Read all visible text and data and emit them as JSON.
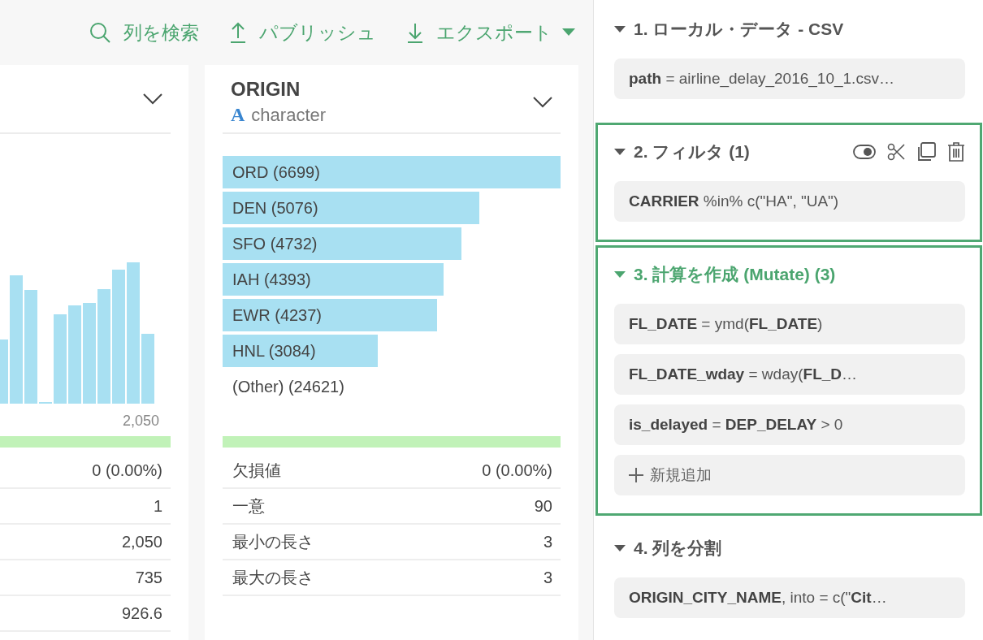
{
  "toolbar": [
    {
      "kind": "search",
      "label": "列を検索"
    },
    {
      "kind": "publish",
      "label": "パブリッシュ"
    },
    {
      "kind": "export",
      "label": "エクスポート",
      "dropdown": true
    }
  ],
  "columns": [
    {
      "kind": "histogram",
      "axis_label": "2,050",
      "valid_bar": {
        "level": 1
      },
      "stats": [
        {
          "value": "0 (0.00%)"
        },
        {
          "value": "1"
        },
        {
          "value": "2,050"
        },
        {
          "value": "735"
        },
        {
          "value": "926.6"
        }
      ]
    },
    {
      "kind": "category",
      "name": "ORIGIN",
      "type_icon": "A",
      "type": "character",
      "valid_bar": {
        "level": 1
      },
      "categories": [
        {
          "label": "ORD (6699)",
          "level": 1
        },
        {
          "label": "DEN (5076)",
          "level": 0.76
        },
        {
          "label": "SFO (4732)",
          "level": 0.707
        },
        {
          "label": "IAH (4393)",
          "level": 0.654
        },
        {
          "label": "EWR (4237)",
          "level": 0.635
        },
        {
          "label": "HNL (3084)",
          "level": 0.46
        },
        {
          "label": "(Other) (24621)"
        }
      ],
      "stats": [
        {
          "label": "欠損値",
          "value": "0 (0.00%)"
        },
        {
          "label": "一意",
          "value": "90"
        },
        {
          "label": "最小の長さ",
          "value": "3"
        },
        {
          "label": "最大の長さ",
          "value": "3"
        }
      ]
    }
  ],
  "steps": [
    {
      "title": "1. ローカル・データ - CSV",
      "expanded": true,
      "selected": false,
      "highlighted": false,
      "actions": false,
      "items": [
        {
          "kind": "expr",
          "text": "**path** = airline_delay_2016_10_1.csv…"
        }
      ]
    },
    {
      "title": "2. フィルタ (1)",
      "expanded": true,
      "selected": false,
      "highlighted": true,
      "actions": true,
      "items": [
        {
          "kind": "expr",
          "text": "**CARRIER** %in% c(\"HA\", \"UA\")"
        }
      ]
    },
    {
      "title": "3. 計算を作成 (Mutate) (3)",
      "expanded": true,
      "selected": true,
      "highlighted": true,
      "actions": false,
      "items": [
        {
          "kind": "expr",
          "text": "**FL_DATE** = ymd(**FL_DATE**)"
        },
        {
          "kind": "expr",
          "text": "**FL_DATE_wday** = wday(**FL_D**…"
        },
        {
          "kind": "expr",
          "text": "**is_delayed** = **DEP_DELAY** > 0"
        },
        {
          "kind": "add",
          "text": "新規追加"
        }
      ]
    },
    {
      "title": "4. 列を分割",
      "expanded": true,
      "selected": false,
      "highlighted": false,
      "actions": false,
      "items": [
        {
          "kind": "expr",
          "text": "**ORIGIN_CITY_NAME**, into = c(\"**Cit**…"
        }
      ]
    }
  ]
}
